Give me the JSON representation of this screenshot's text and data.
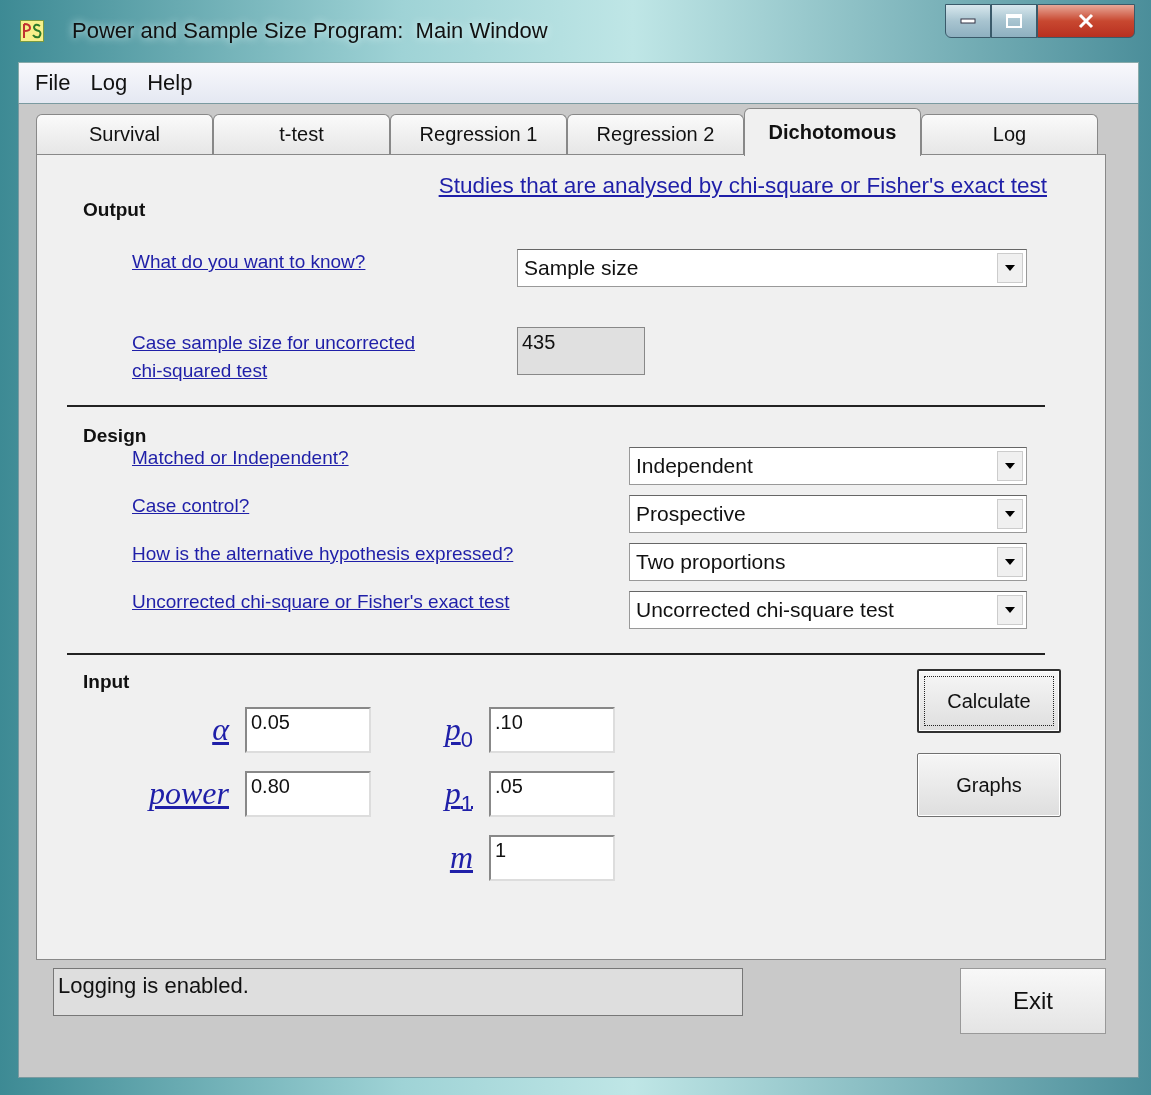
{
  "window": {
    "title": "Power and Sample Size Program:  Main Window"
  },
  "menu": [
    "File",
    "Log",
    "Help"
  ],
  "tabs": [
    {
      "label": "Survival",
      "selected": false
    },
    {
      "label": "t-test",
      "selected": false
    },
    {
      "label": "Regression 1",
      "selected": false
    },
    {
      "label": "Regression 2",
      "selected": false
    },
    {
      "label": "Dichotomous",
      "selected": true
    },
    {
      "label": "Log",
      "selected": false
    }
  ],
  "panel_link": "Studies that are analysed by chi-square or Fisher's exact test",
  "output": {
    "heading": "Output",
    "rows": [
      {
        "label": "What do you want to know?",
        "kind": "dropdown",
        "value": "Sample size"
      },
      {
        "label": "Case sample size for uncorrected chi-squared test",
        "kind": "readonly",
        "value": "435"
      }
    ]
  },
  "design": {
    "heading": "Design",
    "rows": [
      {
        "label": "Matched or Independent?",
        "kind": "dropdown",
        "value": "Independent"
      },
      {
        "label": "Case control?",
        "kind": "dropdown",
        "value": "Prospective"
      },
      {
        "label": "How is the alternative hypothesis expressed?",
        "kind": "dropdown",
        "value": "Two proportions"
      },
      {
        "label": "Uncorrected chi-square or Fisher's exact test",
        "kind": "dropdown",
        "value": "Uncorrected chi-square test"
      }
    ]
  },
  "input": {
    "heading": "Input",
    "fields": [
      {
        "symbol": "α",
        "value": "0.05"
      },
      {
        "symbol": "p$_{0}$",
        "value": ".10"
      },
      {
        "symbol": "power",
        "value": "0.80"
      },
      {
        "symbol": "p$_{1}$",
        "value": ".05"
      },
      {
        "symbol": "m",
        "value": "1"
      }
    ]
  },
  "buttons": [
    {
      "label": "Calculate",
      "focused": true
    },
    {
      "label": "Graphs",
      "focused": false
    }
  ],
  "status": "Logging is enabled.",
  "exit_button": "Exit"
}
